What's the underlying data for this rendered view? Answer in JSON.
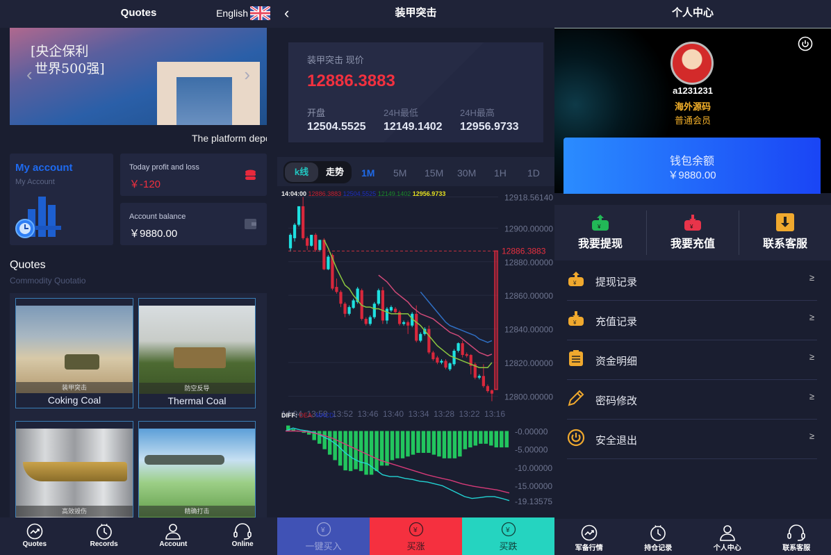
{
  "left": {
    "title": "Quotes",
    "language": "English",
    "banner_text": [
      "[央企保利",
      "世界500强]"
    ],
    "marquee": "The platform depo",
    "account": {
      "title": "My account",
      "subtitle": "My Account"
    },
    "profit": {
      "label": "Today profit and loss",
      "value": "￥-120"
    },
    "balance": {
      "label": "Account balance",
      "value": "￥9880.00"
    },
    "quotes": {
      "title": "Quotes",
      "subtitle": "Commodity Quotatio"
    },
    "tiles": [
      {
        "caption": "装甲突击",
        "name": "Coking Coal"
      },
      {
        "caption": "防空反导",
        "name": "Thermal Coal"
      },
      {
        "caption": "高效毁伤",
        "name": ""
      },
      {
        "caption": "精确打击",
        "name": ""
      }
    ],
    "nav": [
      {
        "label": "Quotes",
        "icon": "trend-icon"
      },
      {
        "label": "Records",
        "icon": "clock-icon"
      },
      {
        "label": "Account",
        "icon": "user-icon"
      },
      {
        "label": "Online",
        "icon": "headset-icon"
      }
    ]
  },
  "middle": {
    "title": "装甲突击",
    "price_label": "装甲突击 现价",
    "price": "12886.3883",
    "stats": [
      {
        "label": "开盘",
        "value": "12504.5525"
      },
      {
        "label": "24H最低",
        "value": "12149.1402"
      },
      {
        "label": "24H最高",
        "value": "12956.9733"
      }
    ],
    "chart_tabs": [
      "k线",
      "走势"
    ],
    "timeframes": [
      "1M",
      "5M",
      "15M",
      "30M",
      "1H",
      "1D"
    ],
    "active_timeframe": "1M",
    "legend": {
      "time": "14:04:00",
      "v1": "12886.3883",
      "v2": "12504.5525",
      "v3": "12149.1402",
      "v4": "12956.9733"
    },
    "macd_legend": [
      "DIFF:",
      "DEA:",
      "MACD:"
    ],
    "buttons": [
      {
        "label": "一键买入",
        "color": "#4052b5"
      },
      {
        "label": "买涨",
        "color": "#f5303f"
      },
      {
        "label": "买跌",
        "color": "#25d4c0"
      }
    ]
  },
  "chart_data": [
    {
      "type": "candlestick",
      "ylim": [
        12796,
        12920
      ],
      "y_ticks": [
        "12918.56140",
        "12900.00000",
        "12880.00000",
        "12860.00000",
        "12840.00000",
        "12820.00000",
        "12800.00000"
      ],
      "y_tick_values": [
        12918.5614,
        12900,
        12880,
        12860,
        12840,
        12820,
        12800
      ],
      "current_price_label": "12886.3883",
      "current_price": 12886.3883,
      "x_ticks": [
        "14:04",
        "13:58",
        "13:52",
        "13:46",
        "13:40",
        "13:34",
        "13:28",
        "13:22",
        "13:16"
      ],
      "candles_ohlc": [
        [
          12888,
          12897,
          12886,
          12896
        ],
        [
          12894,
          12903,
          12892,
          12902
        ],
        [
          12902,
          12913,
          12901,
          12913
        ],
        [
          12913,
          12918.5,
          12893,
          12894
        ],
        [
          12894,
          12895,
          12887,
          12889.5
        ],
        [
          12889.5,
          12896,
          12889,
          12896
        ],
        [
          12896,
          12897,
          12886,
          12887
        ],
        [
          12887,
          12893,
          12886,
          12893
        ],
        [
          12893,
          12894,
          12875,
          12875.5
        ],
        [
          12875.5,
          12884,
          12875,
          12883
        ],
        [
          12884,
          12885,
          12863,
          12864
        ],
        [
          12865,
          12870,
          12861,
          12862
        ],
        [
          12862,
          12863,
          12853,
          12855
        ],
        [
          12855,
          12856,
          12847,
          12849
        ],
        [
          12849,
          12854,
          12848,
          12853
        ],
        [
          12852.5,
          12858,
          12852,
          12857
        ],
        [
          12856,
          12865,
          12855,
          12864
        ],
        [
          12863,
          12864,
          12845,
          12846
        ],
        [
          12846,
          12847,
          12842,
          12843
        ],
        [
          12843,
          12848,
          12842,
          12847
        ],
        [
          12847,
          12856,
          12846,
          12855
        ],
        [
          12855,
          12864,
          12854,
          12863
        ],
        [
          12863,
          12865,
          12843,
          12845
        ],
        [
          12845,
          12853,
          12843,
          12852
        ],
        [
          12851,
          12854,
          12850,
          12853
        ],
        [
          12852,
          12853,
          12849,
          12850
        ],
        [
          12850,
          12851,
          12842,
          12843
        ],
        [
          12843,
          12845,
          12842,
          12844
        ],
        [
          12844,
          12845,
          12837,
          12842
        ],
        [
          12842,
          12850,
          12841,
          12849
        ],
        [
          12849,
          12854,
          12832,
          12833
        ],
        [
          12833,
          12838,
          12832,
          12837
        ],
        [
          12837,
          12841,
          12836,
          12840
        ],
        [
          12840,
          12842,
          12825,
          12826
        ],
        [
          12826,
          12827,
          12821,
          12822
        ],
        [
          12823,
          12824,
          12819,
          12820
        ],
        [
          12820,
          12822,
          12819,
          12821
        ],
        [
          12821,
          12822,
          12816,
          12817
        ],
        [
          12816,
          12820,
          12815,
          12819.5
        ],
        [
          12819,
          12828,
          12818,
          12827
        ],
        [
          12827,
          12832,
          12826,
          12831.5
        ],
        [
          12831.5,
          12833,
          12823,
          12824.5
        ],
        [
          12825,
          12826,
          12823,
          12824
        ],
        [
          12824.5,
          12825,
          12813,
          12818
        ],
        [
          12819,
          12820,
          12810,
          12811
        ],
        [
          12811,
          12813,
          12810,
          12812
        ],
        [
          12812,
          12819,
          12805,
          12806
        ],
        [
          12806,
          12807,
          12802,
          12803
        ],
        [
          12803.5,
          12804,
          12797,
          12801.5
        ],
        [
          12886.4,
          12886.4,
          12804,
          12804
        ]
      ],
      "ma": [
        {
          "color": "#8cc63f",
          "start": 8,
          "values": [
            12893,
            12888,
            12882,
            12876,
            12871,
            12866,
            12864,
            12860,
            12857,
            12854,
            12853,
            12853,
            12852,
            12852,
            12851,
            12850,
            12849,
            12849,
            12849,
            12849,
            12849,
            12846,
            12844,
            12842,
            12839,
            12836,
            12833,
            12830,
            12828,
            12826,
            12824,
            12823,
            12822,
            12821,
            12820,
            12819,
            12818,
            12817,
            12817,
            12817,
            12820
          ]
        },
        {
          "color": "#d04a78",
          "start": 21,
          "values": [
            12872,
            12870,
            12868,
            12865,
            12862,
            12860,
            12858,
            12856,
            12853,
            12851,
            12849,
            12848,
            12847,
            12846,
            12844,
            12842,
            12840,
            12838,
            12837,
            12836,
            12834,
            12832,
            12830,
            12828,
            12826,
            12825,
            12824,
            12825
          ]
        },
        {
          "color": "#2f6fc4",
          "start": 31,
          "values": [
            12862,
            12859,
            12856,
            12853,
            12850,
            12847,
            12844,
            12842,
            12841,
            12840,
            12839,
            12838,
            12837,
            12836,
            12834,
            12833,
            12832,
            12833
          ]
        }
      ]
    },
    {
      "type": "bar+line",
      "ylim": [
        -20.5,
        2
      ],
      "y_ticks": [
        "-0.00000",
        "-5.00000",
        "-10.00000",
        "-15.00000",
        "-19.13575"
      ],
      "y_tick_values": [
        0,
        -5,
        -10,
        -15,
        -19.13575
      ],
      "macd": [
        1.5,
        0.5,
        0,
        -0.5,
        -1,
        -2.5,
        -3.5,
        -5,
        -6.5,
        -8,
        -9.5,
        -10.8,
        -11,
        -10.5,
        -11,
        -12,
        -12,
        -11,
        -9.5,
        -9.5,
        -8,
        -7.5,
        -7.5,
        -7,
        -6.5,
        -6,
        -6,
        -6,
        -6.5,
        -7,
        -7.5,
        -7.5,
        -7.5,
        -7,
        -5,
        -4.5,
        -4,
        -3.5,
        -3.5,
        -4,
        -4.5,
        -4.5,
        -4.5
      ],
      "diff": [
        0,
        0.8,
        0.3,
        0,
        -0.5,
        -1.5,
        -2.5,
        -4,
        -6,
        -7.5,
        -8.5,
        -9,
        -10.5,
        -12,
        -12.5,
        -12.5,
        -13,
        -13.3,
        -13.8,
        -14,
        -14.5,
        -15,
        -16,
        -17,
        -18,
        -18.5,
        -18.3,
        -18,
        -18,
        -18.5,
        -19.1
      ],
      "dea": [
        0,
        0,
        -0.3,
        -1,
        -2,
        -3.5,
        -5,
        -6.5,
        -8,
        -9,
        -10,
        -11,
        -12,
        -12.8,
        -13.5,
        -14.5,
        -15.2,
        -15.7,
        -16.2,
        -17
      ],
      "colors": {
        "macd": "#22c55e",
        "diff": "#22d3d3",
        "dea": "#d63a78"
      }
    }
  ],
  "right": {
    "title": "个人中心",
    "username": "a1231231",
    "nickname": "海外源码",
    "level": "普通会员",
    "wallet": {
      "label": "钱包余额",
      "value": "￥9880.00"
    },
    "actions": [
      {
        "label": "我要提现",
        "color": "#22b857"
      },
      {
        "label": "我要充值",
        "color": "#e8344a"
      },
      {
        "label": "联系客服",
        "color": "#f0a92e"
      }
    ],
    "list": [
      {
        "label": "提现记录",
        "icon": "withdraw-record-icon"
      },
      {
        "label": "充值记录",
        "icon": "recharge-record-icon"
      },
      {
        "label": "资金明细",
        "icon": "clipboard-icon"
      },
      {
        "label": "密码修改",
        "icon": "pencil-icon"
      },
      {
        "label": "安全退出",
        "icon": "power-icon"
      }
    ],
    "chevron": "≥",
    "nav": [
      {
        "label": "军备行情",
        "icon": "trend-icon"
      },
      {
        "label": "持仓记录",
        "icon": "clock-icon"
      },
      {
        "label": "个人中心",
        "icon": "user-icon"
      },
      {
        "label": "联系客服",
        "icon": "headset-icon"
      }
    ]
  }
}
